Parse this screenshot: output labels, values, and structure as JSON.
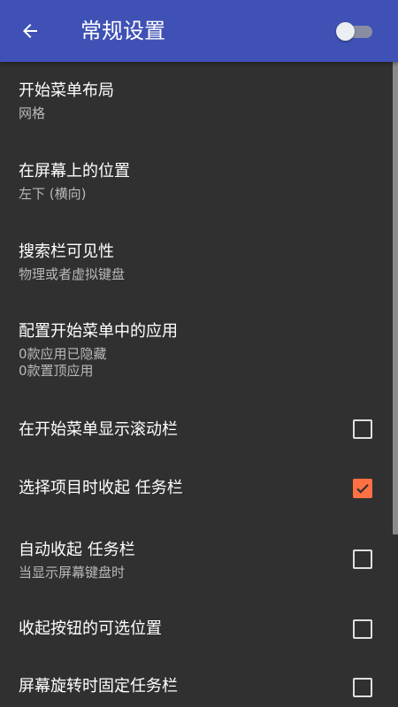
{
  "toolbar": {
    "title": "常规设置",
    "back_icon": "arrow-back-icon",
    "toggle_on": false,
    "color": "#3f51b5"
  },
  "preferences": [
    {
      "title": "开始菜单布局",
      "summary": [
        "网格"
      ]
    },
    {
      "title": "在屏幕上的位置",
      "summary": [
        "左下 (横向)"
      ]
    },
    {
      "title": "搜索栏可见性",
      "summary": [
        "物理或者虚拟键盘"
      ]
    },
    {
      "title": "配置开始菜单中的应用",
      "summary": [
        "0款应用已隐藏",
        "0款置顶应用"
      ]
    },
    {
      "title": "在开始菜单显示滚动栏",
      "checked": false
    },
    {
      "title": "选择项目时收起 任务栏",
      "checked": true
    },
    {
      "title": "自动收起 任务栏",
      "summary": [
        "当显示屏幕键盘时"
      ],
      "checked": false
    },
    {
      "title": "收起按钮的可选位置",
      "checked": false
    },
    {
      "title": "屏幕旋转时固定任务栏",
      "checked": false
    }
  ],
  "colors": {
    "background": "#303030",
    "accent": "#ff7043",
    "summary_text": "#b9b9b9"
  }
}
